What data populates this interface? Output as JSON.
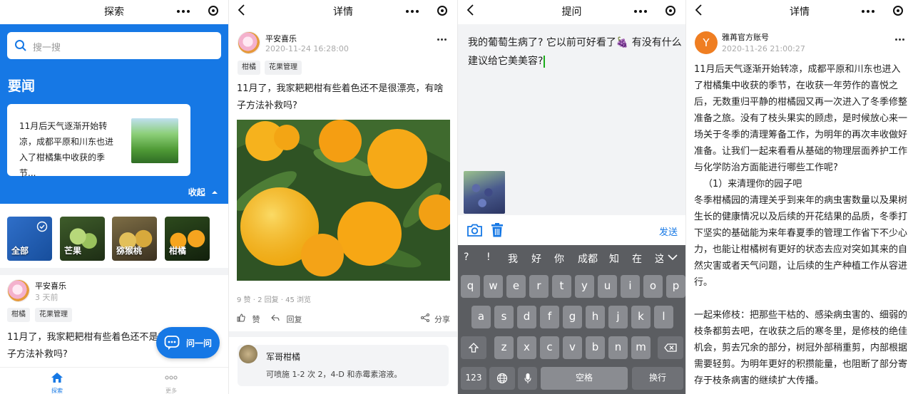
{
  "panel1": {
    "title": "探索",
    "search_placeholder": "搜一搜",
    "section_title": "要闻",
    "news_text": "11月后天气逐渐开始转凉，成都平原和川东也进入了柑橘集中收获的季节...",
    "collapse_label": "收起",
    "categories": [
      {
        "label": "全部"
      },
      {
        "label": "芒果"
      },
      {
        "label": "猕猴桃"
      },
      {
        "label": "柑橘"
      }
    ],
    "post": {
      "username": "平安喜乐",
      "time": "3 天前",
      "tags": [
        "柑橘",
        "花果管理"
      ],
      "text": "11月了，我家耙耙柑有些着色还不是很漂亮，有啥子方法补救吗?"
    },
    "fab_label": "问一问",
    "tabs": [
      {
        "label": "探索",
        "active": true
      },
      {
        "label": "更多",
        "active": false
      }
    ]
  },
  "panel2": {
    "title": "详情",
    "username": "平安喜乐",
    "time": "2020-11-24 16:28:00",
    "tags": [
      "柑橘",
      "花果管理"
    ],
    "text": "11月了，我家耙耙柑有些着色还不是很漂亮，有啥子方法补救吗?",
    "stats": "9 赞 · 2 回复 · 45 浏览",
    "actions": {
      "like": "赞",
      "reply": "回复",
      "share": "分享"
    },
    "comment": {
      "name": "军哥柑橘",
      "text": "可喷施 1-2 次 2，4-D 和赤霉素溶液。"
    }
  },
  "panel3": {
    "title": "提问",
    "question": "我的葡萄生病了? 它以前可好看了🍇 有没有什么建议给它美美容?",
    "send_label": "发送",
    "candidates": [
      "?",
      "!",
      "我",
      "好",
      "你",
      "成都",
      "知",
      "在",
      "这"
    ],
    "row1": [
      "q",
      "w",
      "e",
      "r",
      "t",
      "y",
      "u",
      "i",
      "o",
      "p"
    ],
    "row2": [
      "a",
      "s",
      "d",
      "f",
      "g",
      "h",
      "j",
      "k",
      "l"
    ],
    "row3": [
      "z",
      "x",
      "c",
      "v",
      "b",
      "n",
      "m"
    ],
    "key_123": "123",
    "key_space": "空格",
    "key_return": "换行"
  },
  "panel4": {
    "title": "详情",
    "avatar_letter": "Y",
    "username": "雅苒官方账号",
    "time": "2020-11-26 21:00:27",
    "para1": "11月后天气逐渐开始转凉，成都平原和川东也进入了柑橘集中收获的季节，在收获一年劳作的喜悦之后，无数重归平静的柑橘园又再一次进入了冬季修整准备之旅。没有了枝头果实的顾虑，是时候放心来一场关于冬季的清理筹备工作，为明年的再次丰收做好准备。让我们一起来看看从基础的物理层面养护工作与化学防治方面能进行哪些工作呢?",
    "para2": "（1）来清理你的园子吧",
    "para3": "冬季柑橘园的清理关乎到来年的病虫害数量以及果树生长的健康情况以及后续的开花结果的品质，冬季打下坚实的基础能为来年春夏季的管理工作省下不少心力，也能让柑橘树有更好的状态去应对突如其来的自然灾害或者天气问题，让后续的生产种植工作从容进行。",
    "para4": "一起来修枝：把那些干枯的、感染病虫害的、细弱的枝条都剪去吧，在收获之后的寒冬里，是修枝的绝佳机会，剪去冗余的部分，树冠外部稍重剪，内部根据需要轻剪。为明年更好的积攒能量，也阻断了部分寄存于枝条病害的继续扩大传播。"
  },
  "colors": {
    "primary": "#1678e5",
    "avatar_orange": "#ef7e22",
    "keyboard_bg": "#5b5d61"
  }
}
